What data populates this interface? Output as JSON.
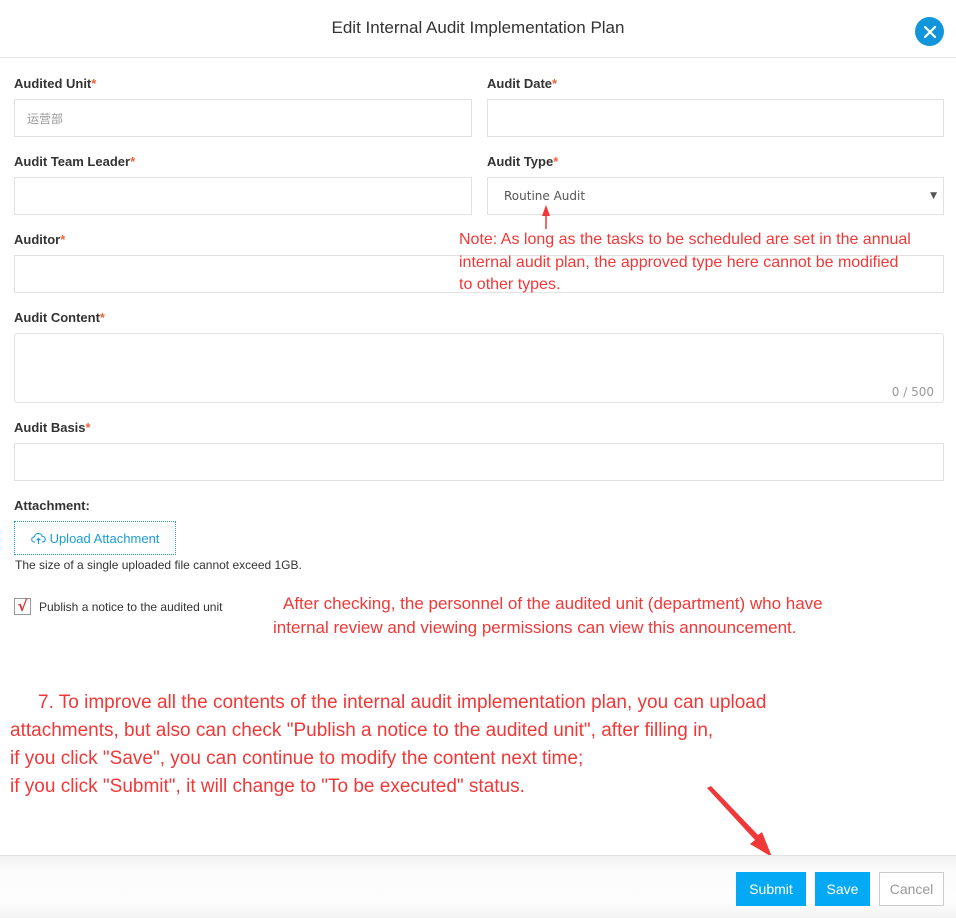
{
  "header": {
    "title": "Edit Internal Audit Implementation Plan",
    "close_icon": "close-icon"
  },
  "form": {
    "required_mark": "*",
    "audited_unit": {
      "label": "Audited Unit",
      "value": "运营部"
    },
    "audit_date": {
      "label": "Audit Date",
      "value": ""
    },
    "audit_team_leader": {
      "label": "Audit Team Leader",
      "value": ""
    },
    "audit_type": {
      "label": "Audit Type",
      "selected": "Routine Audit",
      "arrow": "▼"
    },
    "auditor": {
      "label": "Auditor",
      "value": ""
    },
    "audit_content": {
      "label": "Audit Content",
      "value": "",
      "counter": "0 / 500"
    },
    "audit_basis": {
      "label": "Audit Basis",
      "value": ""
    },
    "attachment": {
      "label": "Attachment:",
      "upload_button": "Upload Attachment",
      "upload_icon": "cloud-upload-icon",
      "hint": "The size of a single uploaded file cannot exceed 1GB."
    },
    "publish_notice": {
      "label": "Publish a notice to the audited unit",
      "checked": true,
      "check_glyph": "√"
    }
  },
  "annotations": {
    "color": "#f03838",
    "type_note": [
      "Note: As long as the tasks to be scheduled are set in the annual",
      "internal audit plan, the approved type here cannot be modified",
      "to other types."
    ],
    "check_note": [
      "After checking, the personnel of the audited unit (department) who have",
      "internal review and viewing permissions can view this announcement."
    ],
    "main_note": [
      "7. To improve all the contents of the internal audit implementation plan, you can upload",
      "attachments, but also can check \"Publish a notice to the audited unit\", after filling in,",
      "if you click \"Save\", you can continue to modify the content next time;",
      "if you click \"Submit\", it will change to \"To be executed\" status."
    ]
  },
  "footer": {
    "submit": "Submit",
    "save": "Save",
    "cancel": "Cancel",
    "primary_color": "#03a9f4"
  }
}
